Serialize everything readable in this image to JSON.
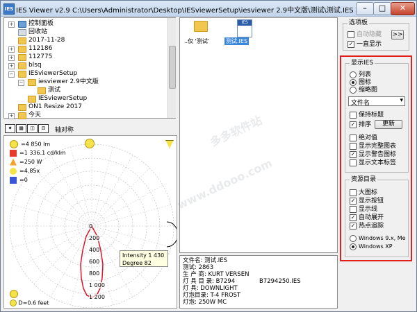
{
  "window": {
    "title": "IES Viewer v2.9    C:\\Users\\Administrator\\Desktop\\IESviewerSetup\\iesviewer 2.9中文版\\测试\\测试.IES",
    "app_icon": "IES",
    "minimize": "–",
    "maximize": "□",
    "close": "✕"
  },
  "tree": {
    "items": [
      {
        "label": "控制面板",
        "expander": "+"
      },
      {
        "label": "回收站",
        "expander": ""
      },
      {
        "label": "2017-11-28",
        "expander": ""
      },
      {
        "label": "112186",
        "expander": "+"
      },
      {
        "label": "112775",
        "expander": "+"
      },
      {
        "label": "blsq",
        "expander": "+"
      },
      {
        "label": "IESviewerSetup",
        "expander": "−"
      },
      {
        "label": "iesviewer 2.9中文版",
        "expander": "−"
      },
      {
        "label": "测试",
        "expander": ""
      },
      {
        "label": "IESviewerSetup",
        "expander": ""
      },
      {
        "label": "ON1 Resize 2017",
        "expander": ""
      },
      {
        "label": "今天",
        "expander": "+"
      }
    ]
  },
  "files": {
    "items": [
      {
        "label": "..仅 '测试'",
        "icon": "folder-icon"
      },
      {
        "label": "测试.IES",
        "icon": "ies-file-icon",
        "badge": "IES"
      }
    ]
  },
  "toolbar": {
    "axis_label": "轴对称",
    "icon_glyphs": [
      "✷",
      "▦",
      "◫",
      "⊟"
    ]
  },
  "legend": {
    "flux": "=4 850 lm",
    "intensity": "=1 336.1 cd/klm",
    "power": "=250 W",
    "ratio": "=4.85x",
    "zero": "=0"
  },
  "polar": {
    "ticks": [
      "0",
      "200",
      "400",
      "600",
      "800",
      "1 000",
      "1 200"
    ],
    "tooltip_line1": "Intensity 1 430",
    "tooltip_line2": "Degree 82",
    "distance": "D=0.6 feet"
  },
  "info": {
    "lines": [
      "文件名:  测试.IES",
      "测试: 2863",
      "生 产 商:  KURT VERSEN",
      "灯  具  目  录: B7294",
      "灯      具: DOWNLIGHT",
      "灯泡目录:  T-4 FROST",
      "灯泡: 250W MC"
    ],
    "extra": "B7294250.IES"
  },
  "panel": {
    "options_title": "选项板",
    "auto_hide": "自动隐藏",
    "always_show": "一直显示",
    "more_btn": ">>",
    "display_title": "显示IES",
    "list": "列表",
    "icons": "图标",
    "thumbs": "缩略图",
    "sort_value": "文件名",
    "sort_arrow": "▾",
    "keep_title": "保持标题",
    "sort": "排序",
    "update_btn": "更新",
    "absolute": "绝对值",
    "full_chart": "显示完整图表",
    "warn_icon": "显示警告图标",
    "text_label": "显示文本标签",
    "res_title": "资源目录",
    "big_icons": "大图标",
    "show_buttons": "显示按钮",
    "show_lines": "显示线",
    "auto_expand": "自动展开",
    "hot_track": "热点追踪",
    "win9x": "Windows 9.x, Me",
    "winxp": "Windows XP"
  },
  "colors": {
    "highlight_border": "#e0201c",
    "polar_curve": "#d8142a",
    "selected_file": "#3a86d8"
  },
  "watermark": {
    "text1": "多多软件站",
    "text2": "www.ddooo.com"
  }
}
